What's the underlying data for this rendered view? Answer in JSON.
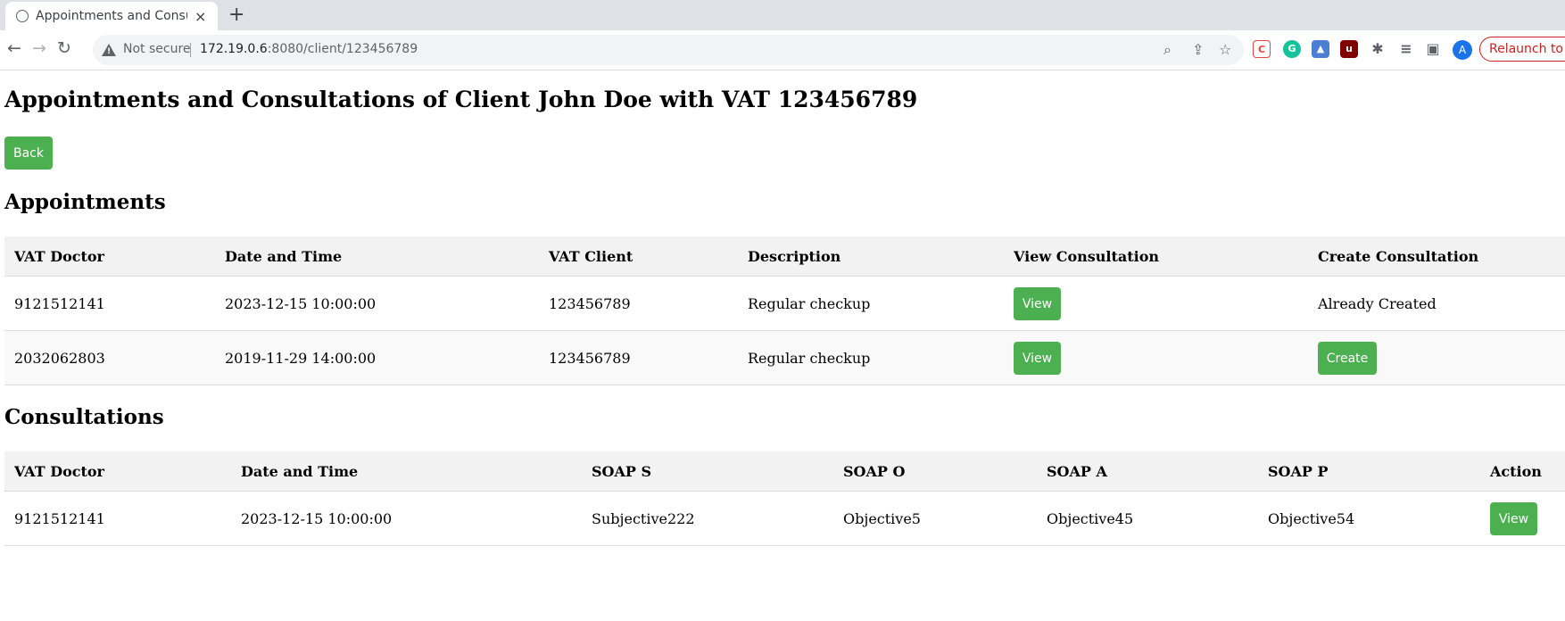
{
  "browser": {
    "tab_title": "Appointments and Consu",
    "tab_close": "×",
    "new_tab": "+",
    "not_secure": "Not secure",
    "url_host": "172.19.0.6",
    "url_rest": ":8080/client/123456789",
    "relaunch": "Relaunch to",
    "avatar_letter": "A"
  },
  "page": {
    "title": "Appointments and Consultations of Client John Doe with VAT 123456789",
    "back_label": "Back",
    "accent_color": "#4caf50"
  },
  "appointments": {
    "heading": "Appointments",
    "headers": [
      "VAT Doctor",
      "Date and Time",
      "VAT Client",
      "Description",
      "View Consultation",
      "Create Consultation"
    ],
    "rows": [
      {
        "vat_doctor": "9121512141",
        "date_time": "2023-12-15 10:00:00",
        "vat_client": "123456789",
        "description": "Regular checkup",
        "view_label": "View",
        "create_text": "Already Created"
      },
      {
        "vat_doctor": "2032062803",
        "date_time": "2019-11-29 14:00:00",
        "vat_client": "123456789",
        "description": "Regular checkup",
        "view_label": "View",
        "create_label": "Create"
      }
    ]
  },
  "consultations": {
    "heading": "Consultations",
    "headers": [
      "VAT Doctor",
      "Date and Time",
      "SOAP S",
      "SOAP O",
      "SOAP A",
      "SOAP P",
      "Action"
    ],
    "rows": [
      {
        "vat_doctor": "9121512141",
        "date_time": "2023-12-15 10:00:00",
        "soap_s": "Subjective222",
        "soap_o": "Objective5",
        "soap_a": "Objective45",
        "soap_p": "Objective54",
        "action_label": "View"
      }
    ]
  }
}
